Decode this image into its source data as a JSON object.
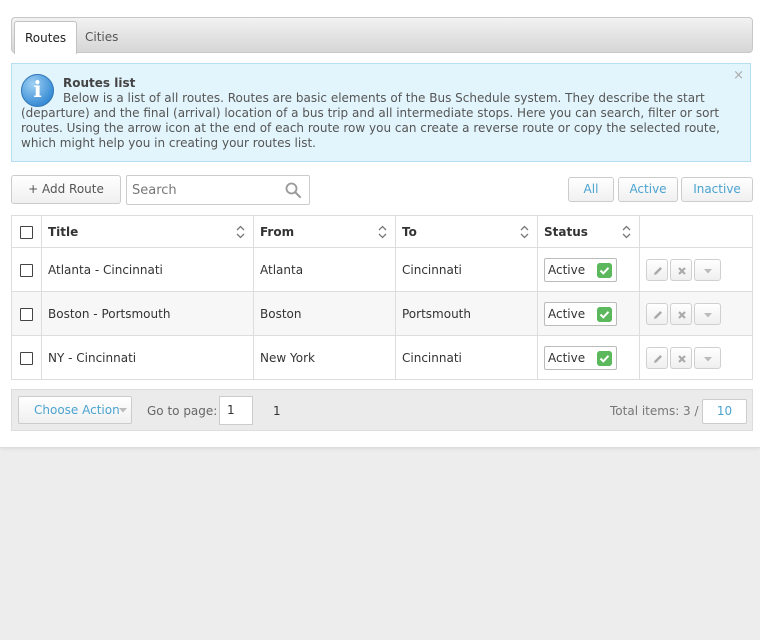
{
  "tabs": [
    {
      "label": "Routes",
      "active": true
    },
    {
      "label": "Cities",
      "active": false
    }
  ],
  "info": {
    "title": "Routes list",
    "text": "Below is a list of all routes. Routes are basic elements of the Bus Schedule system. They describe the start (departure) and the final (arrival) location of a bus trip and all intermediate stops. Here you can search, filter or sort routes. Using the arrow icon at the end of each route row you can create a reverse route or copy the selected route, which might help you in creating your routes list.",
    "icon": "info-icon",
    "close_glyph": "×"
  },
  "toolbar": {
    "add_label": "+ Add Route",
    "search_placeholder": "Search",
    "search_value": "",
    "filters": [
      "All",
      "Active",
      "Inactive"
    ]
  },
  "table": {
    "headers": {
      "title": "Title",
      "from": "From",
      "to": "To",
      "status": "Status"
    },
    "rows": [
      {
        "title": "Atlanta - Cincinnati",
        "from": "Atlanta",
        "to": "Cincinnati",
        "status": "Active"
      },
      {
        "title": "Boston - Portsmouth",
        "from": "Boston",
        "to": "Portsmouth",
        "status": "Active"
      },
      {
        "title": "NY - Cincinnati",
        "from": "New York",
        "to": "Cincinnati",
        "status": "Active"
      }
    ]
  },
  "footer": {
    "choose_action": "Choose Action",
    "goto_label": "Go to page:",
    "goto_value": "1",
    "page": "1",
    "total_label": "Total items: 3 /",
    "per_page": "10"
  },
  "colors": {
    "accent": "#4aa3d0",
    "info_bg": "#e3f5fc",
    "status_green": "#5cb85c"
  }
}
